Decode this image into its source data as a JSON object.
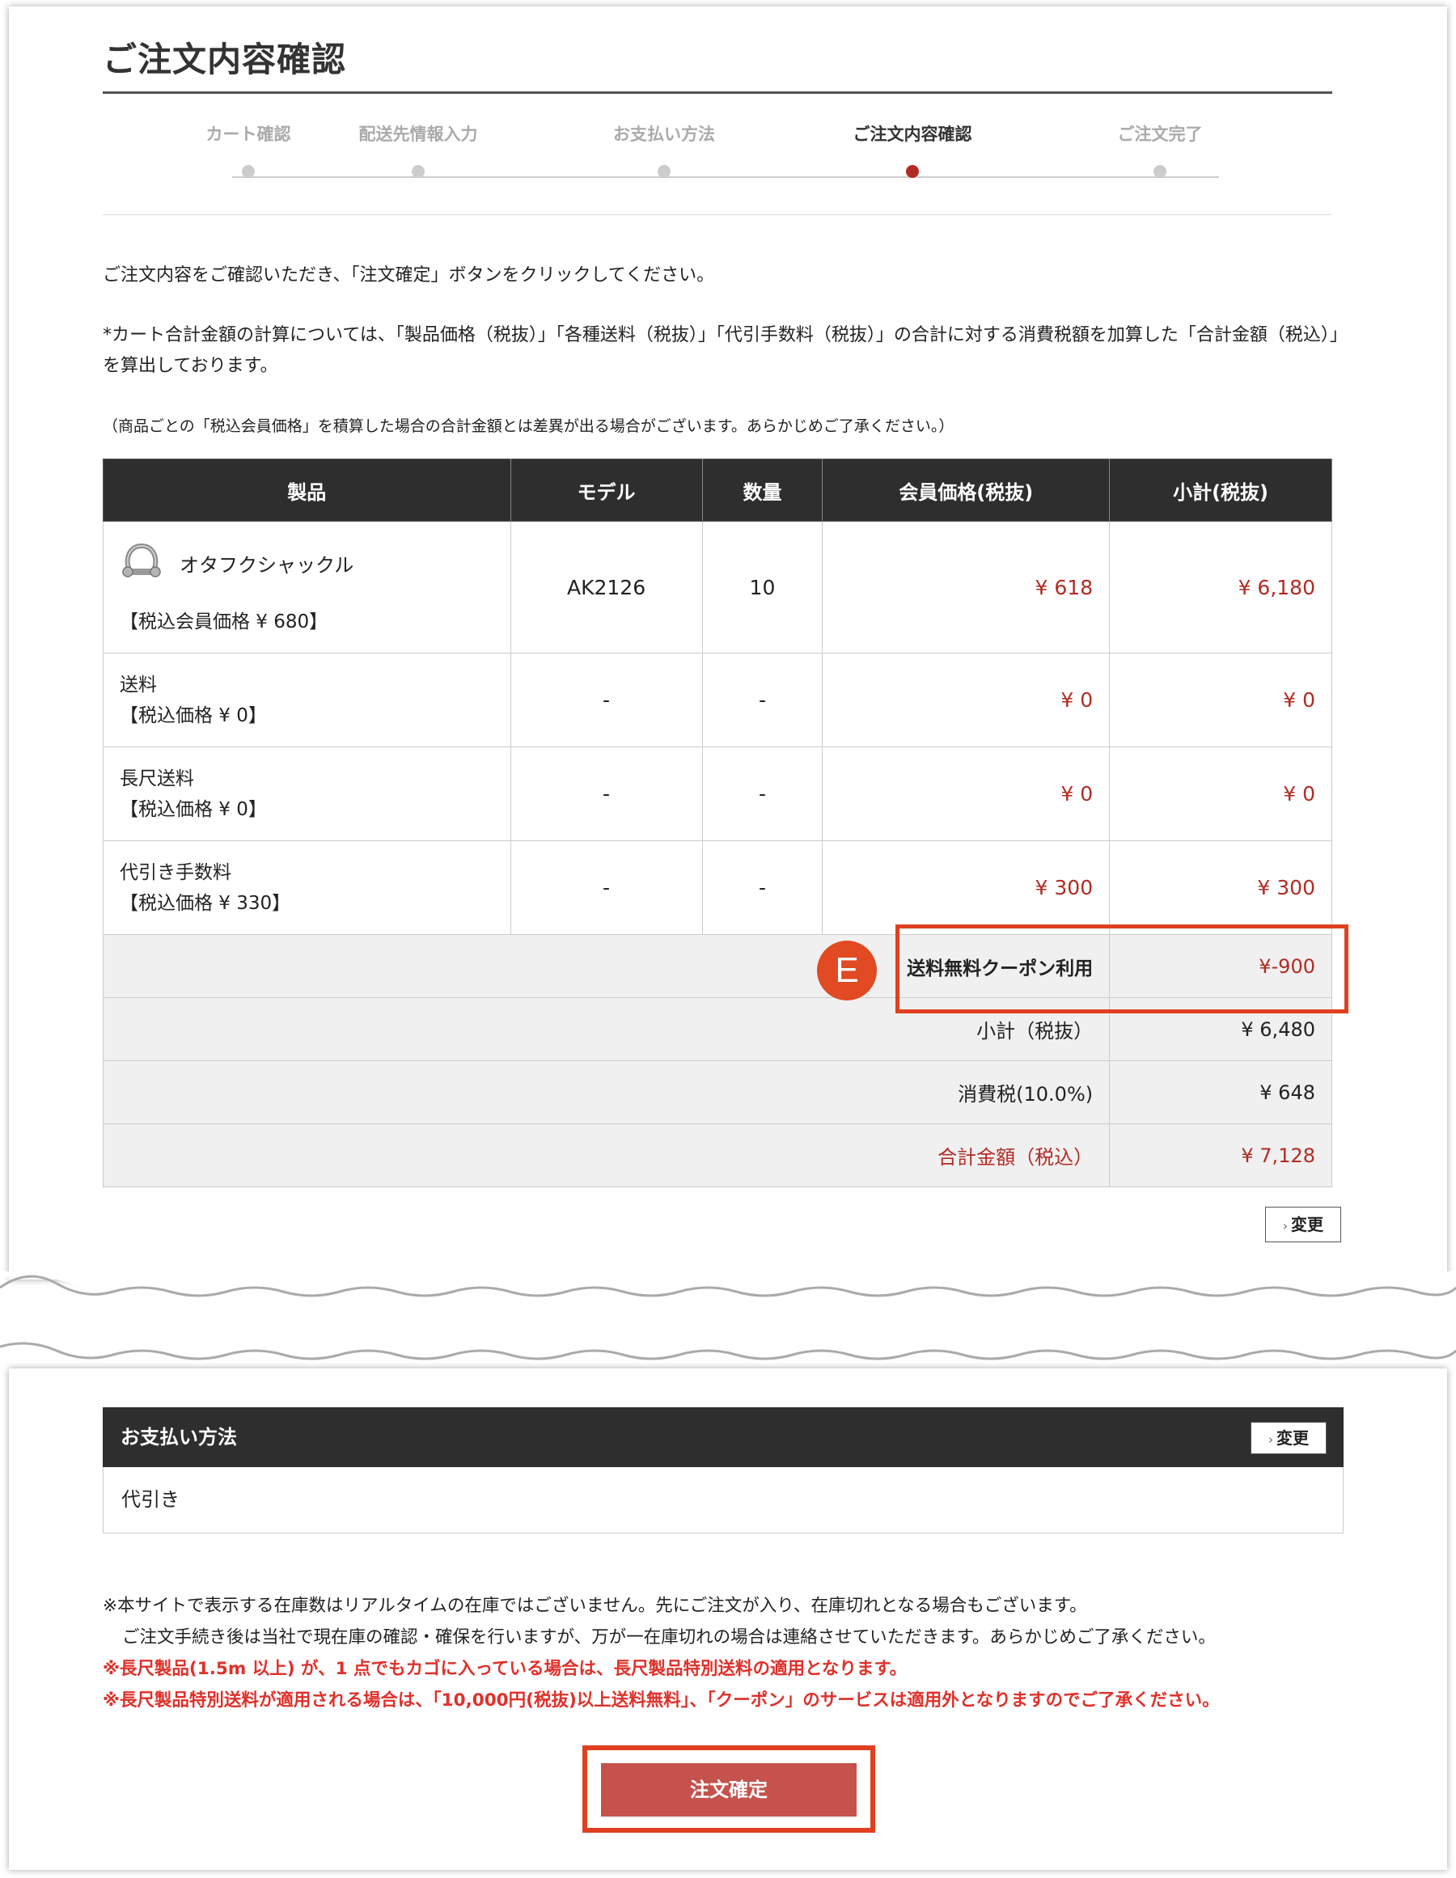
{
  "page": {
    "title": "ご注文内容確認"
  },
  "steps": [
    {
      "label": "カート確認",
      "active": false
    },
    {
      "label": "配送先情報入力",
      "active": false
    },
    {
      "label": "お支払い方法",
      "active": false
    },
    {
      "label": "ご注文内容確認",
      "active": true
    },
    {
      "label": "ご注文完了",
      "active": false
    }
  ],
  "intro": "ご注文内容をご確認いただき、「注文確定」ボタンをクリックしてください。",
  "note_calc": "*カート合計金額の計算については、「製品価格（税抜）」「各種送料（税抜）」「代引手数料（税抜）」の合計に対する消費税額を加算した「合計金額（税込）」を算出しております。",
  "note_diff": "（商品ごとの「税込会員価格」を積算した場合の合計金額とは差異が出る場合がございます。あらかじめご了承ください。）",
  "table": {
    "headers": [
      "製品",
      "モデル",
      "数量",
      "会員価格(税抜)",
      "小計(税抜)"
    ],
    "product": {
      "name": "オタフクシャックル",
      "tax_incl": "【税込会員価格 ¥ 680】",
      "icon": "shackle-icon",
      "model": "AK2126",
      "qty": "10",
      "price": "¥ 618",
      "subtotal": "¥ 6,180"
    },
    "fees": [
      {
        "name": "送料",
        "tax_incl": "【税込価格 ¥ 0】",
        "model": "-",
        "qty": "-",
        "price": "¥ 0",
        "subtotal": "¥ 0"
      },
      {
        "name": "長尺送料",
        "tax_incl": "【税込価格 ¥ 0】",
        "model": "-",
        "qty": "-",
        "price": "¥ 0",
        "subtotal": "¥ 0"
      },
      {
        "name": "代引き手数料",
        "tax_incl": "【税込価格 ¥ 330】",
        "model": "-",
        "qty": "-",
        "price": "¥ 300",
        "subtotal": "¥ 300"
      }
    ],
    "summary": {
      "coupon_label": "送料無料クーポン利用",
      "coupon_value": "¥-900",
      "subtotal_label": "小計（税抜）",
      "subtotal_value": "¥ 6,480",
      "tax_label": "消費税(10.0%)",
      "tax_value": "¥ 648",
      "total_label": "合計金額（税込）",
      "total_value": "¥ 7,128"
    },
    "change_label": "変更"
  },
  "badge": "E",
  "payment": {
    "header": "お支払い方法",
    "change_label": "変更",
    "method": "代引き"
  },
  "notices": {
    "stock1": "※本サイトで表示する在庫数はリアルタイムの在庫ではございません。先にご注文が入り、在庫切れとなる場合もございます。",
    "stock2": "ご注文手続き後は当社で現在庫の確認・確保を行いますが、万が一在庫切れの場合は連絡させていただきます。あらかじめご了承ください。",
    "long1": "※長尺製品(1.5m 以上) が、1 点でもカゴに入っている場合は、長尺製品特別送料の適用となります。",
    "long2": "※長尺製品特別送料が適用される場合は、「10,000円(税抜)以上送料無料」、「クーポン」のサービスは適用外となりますのでご了承ください。"
  },
  "confirm_button": "注文確定",
  "colors": {
    "accent_red": "#b22b22",
    "highlight": "#e04020",
    "header_dark": "#2e2e2e",
    "confirm_bg": "#c5524c"
  }
}
